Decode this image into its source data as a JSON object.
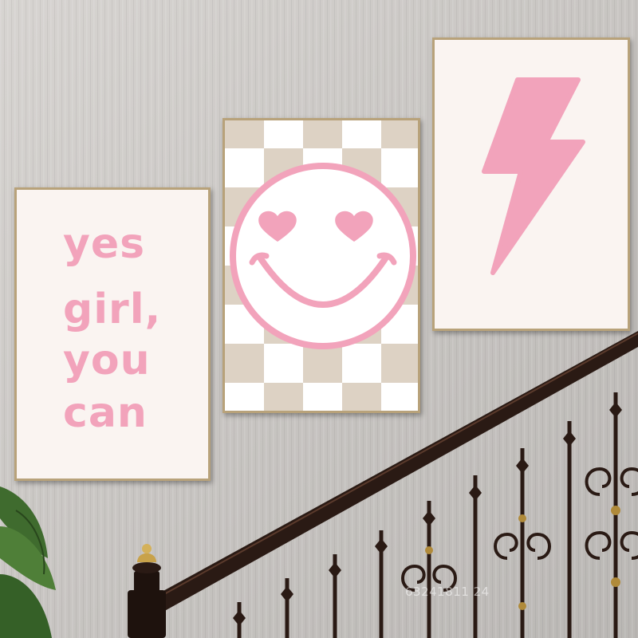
{
  "poster_left": {
    "lines": [
      "yes",
      "girl,",
      "you",
      "can"
    ]
  },
  "poster_middle": {
    "motif": "smiley-face-heart-eyes-icon"
  },
  "poster_right": {
    "motif": "lightning-bolt-icon"
  },
  "watermark": "63241811 24",
  "colors": {
    "wall": "#c9c6c3",
    "pink": "#f2a3bb",
    "poster_bg": "#faf4f1",
    "check_beige": "#ddd2c4",
    "frame_gold": "#b8a27a",
    "railing": "#2a1a14"
  }
}
